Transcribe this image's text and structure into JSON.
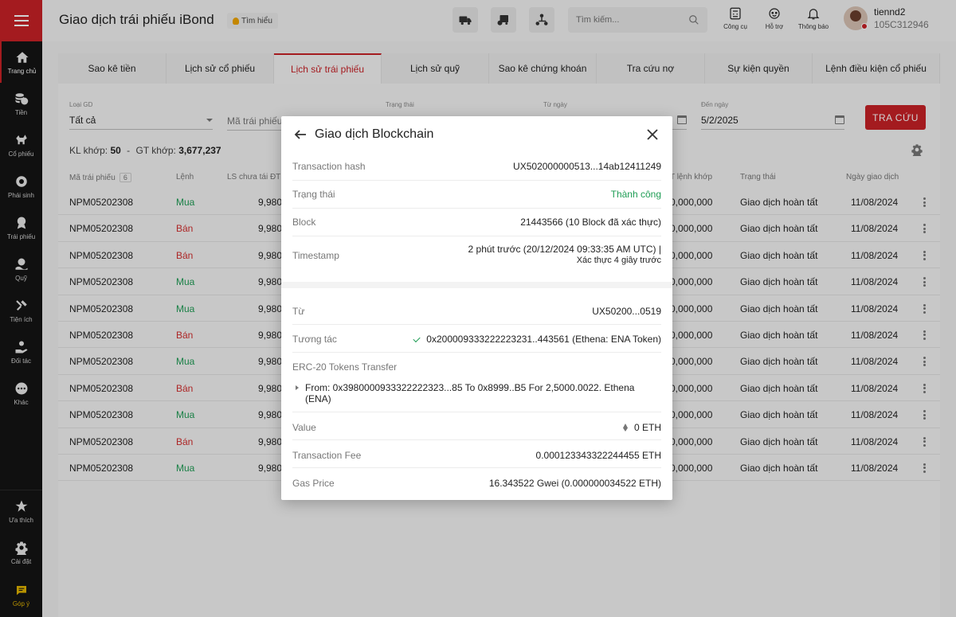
{
  "header": {
    "title": "Giao dịch trái phiếu iBond",
    "learn_label": "Tìm hiểu",
    "search_placeholder": "Tìm kiếm...",
    "tools": [
      "Công cụ",
      "Hỗ trợ",
      "Thông báo"
    ],
    "username": "tiennd2",
    "account_id": "105C312946"
  },
  "sidebar": {
    "items": [
      "Trang chủ",
      "Tiền",
      "Cổ phiếu",
      "Phái sinh",
      "Trái phiếu",
      "Quỹ",
      "Tiện ích",
      "Đối tác",
      "Khác"
    ],
    "bottom": [
      "Ưa thích",
      "Cài đặt",
      "Góp ý"
    ]
  },
  "tabs": [
    "Sao kê tiền",
    "Lịch sử cổ phiếu",
    "Lịch sử trái phiếu",
    "Lịch sử quỹ",
    "Sao kê chứng khoán",
    "Tra cứu nợ",
    "Sự kiện quyền",
    "Lệnh điều kiện cổ phiếu"
  ],
  "filters": {
    "type_label": "Loại GD",
    "type_value": "Tất cả",
    "bond_placeholder": "Mã trái phiếu",
    "status_label": "Trạng thái",
    "from_label": "Từ ngày",
    "to_label": "Đến ngày",
    "to_value": "5/2/2025",
    "search_button": "TRA CỨU"
  },
  "stats": {
    "kl_label": "KL khớp:",
    "kl_value": "50",
    "sep": "-",
    "gt_label": "GT khớp:",
    "gt_value": "3,677,237"
  },
  "table": {
    "headers": {
      "code": "Mã trái phiếu",
      "code_count": "6",
      "order": "Lệnh",
      "ls": "LS chưa tái ĐT",
      "gt": "T lệnh khớp",
      "status": "Trạng thái",
      "date": "Ngày giao dịch"
    },
    "rows": [
      {
        "code": "NPM05202308",
        "order": "Mua",
        "side": "buy",
        "ls": "9,980",
        "gt": "0,000,000",
        "status": "Giao dịch hoàn tất",
        "date": "11/08/2024"
      },
      {
        "code": "NPM05202308",
        "order": "Bán",
        "side": "sell",
        "ls": "9,980",
        "gt": "0,000,000",
        "status": "Giao dịch hoàn tất",
        "date": "11/08/2024"
      },
      {
        "code": "NPM05202308",
        "order": "Bán",
        "side": "sell",
        "ls": "9,980",
        "gt": "0,000,000",
        "status": "Giao dịch hoàn tất",
        "date": "11/08/2024"
      },
      {
        "code": "NPM05202308",
        "order": "Mua",
        "side": "buy",
        "ls": "9,980",
        "gt": "0,000,000",
        "status": "Giao dịch hoàn tất",
        "date": "11/08/2024"
      },
      {
        "code": "NPM05202308",
        "order": "Mua",
        "side": "buy",
        "ls": "9,980",
        "gt": "0,000,000",
        "status": "Giao dịch hoàn tất",
        "date": "11/08/2024"
      },
      {
        "code": "NPM05202308",
        "order": "Bán",
        "side": "sell",
        "ls": "9,980",
        "gt": "0,000,000",
        "status": "Giao dịch hoàn tất",
        "date": "11/08/2024"
      },
      {
        "code": "NPM05202308",
        "order": "Mua",
        "side": "buy",
        "ls": "9,980",
        "gt": "0,000,000",
        "status": "Giao dịch hoàn tất",
        "date": "11/08/2024"
      },
      {
        "code": "NPM05202308",
        "order": "Bán",
        "side": "sell",
        "ls": "9,980",
        "gt": "0,000,000",
        "status": "Giao dịch hoàn tất",
        "date": "11/08/2024"
      },
      {
        "code": "NPM05202308",
        "order": "Mua",
        "side": "buy",
        "ls": "9,980",
        "gt": "0,000,000",
        "status": "Giao dịch hoàn tất",
        "date": "11/08/2024"
      },
      {
        "code": "NPM05202308",
        "order": "Bán",
        "side": "sell",
        "ls": "9,980",
        "gt": "0,000,000",
        "status": "Giao dịch hoàn tất",
        "date": "11/08/2024"
      },
      {
        "code": "NPM05202308",
        "order": "Mua",
        "side": "buy",
        "ls": "9,980",
        "gt": "0,000,000",
        "status": "Giao dịch hoàn tất",
        "date": "11/08/2024"
      }
    ]
  },
  "modal": {
    "title": "Giao dịch Blockchain",
    "tx_hash_label": "Transaction hash",
    "tx_hash": "UX502000000513...14ab12411249",
    "status_label": "Trạng thái",
    "status": "Thành công",
    "block_label": "Block",
    "block": "21443566 (10 Block đã xác thực)",
    "timestamp_label": "Timestamp",
    "timestamp": "2 phút trước (20/12/2024 09:33:35 AM UTC) |",
    "timestamp_sub": "Xác thực 4 giây trước",
    "from_label": "Từ",
    "from": "UX50200...0519",
    "interact_label": "Tương tác",
    "interact": "0x200009333222223231..443561 (Ethena: ENA Token)",
    "erc20_label": "ERC-20 Tokens Transfer",
    "erc20_detail": "From: 0x3980000933322222323...85 To 0x8999..B5 For 2,5000.0022. Ethena (ENA)",
    "value_label": "Value",
    "value": "0 ETH",
    "fee_label": "Transaction Fee",
    "fee": "0.000123343322244455 ETH",
    "gas_label": "Gas Price",
    "gas": "16.343522 Gwei (0.000000034522 ETH)"
  },
  "colors": {
    "brand": "#c92127",
    "buy": "#1f9d55",
    "sell": "#d32f2f",
    "sidebar": "#141414"
  }
}
